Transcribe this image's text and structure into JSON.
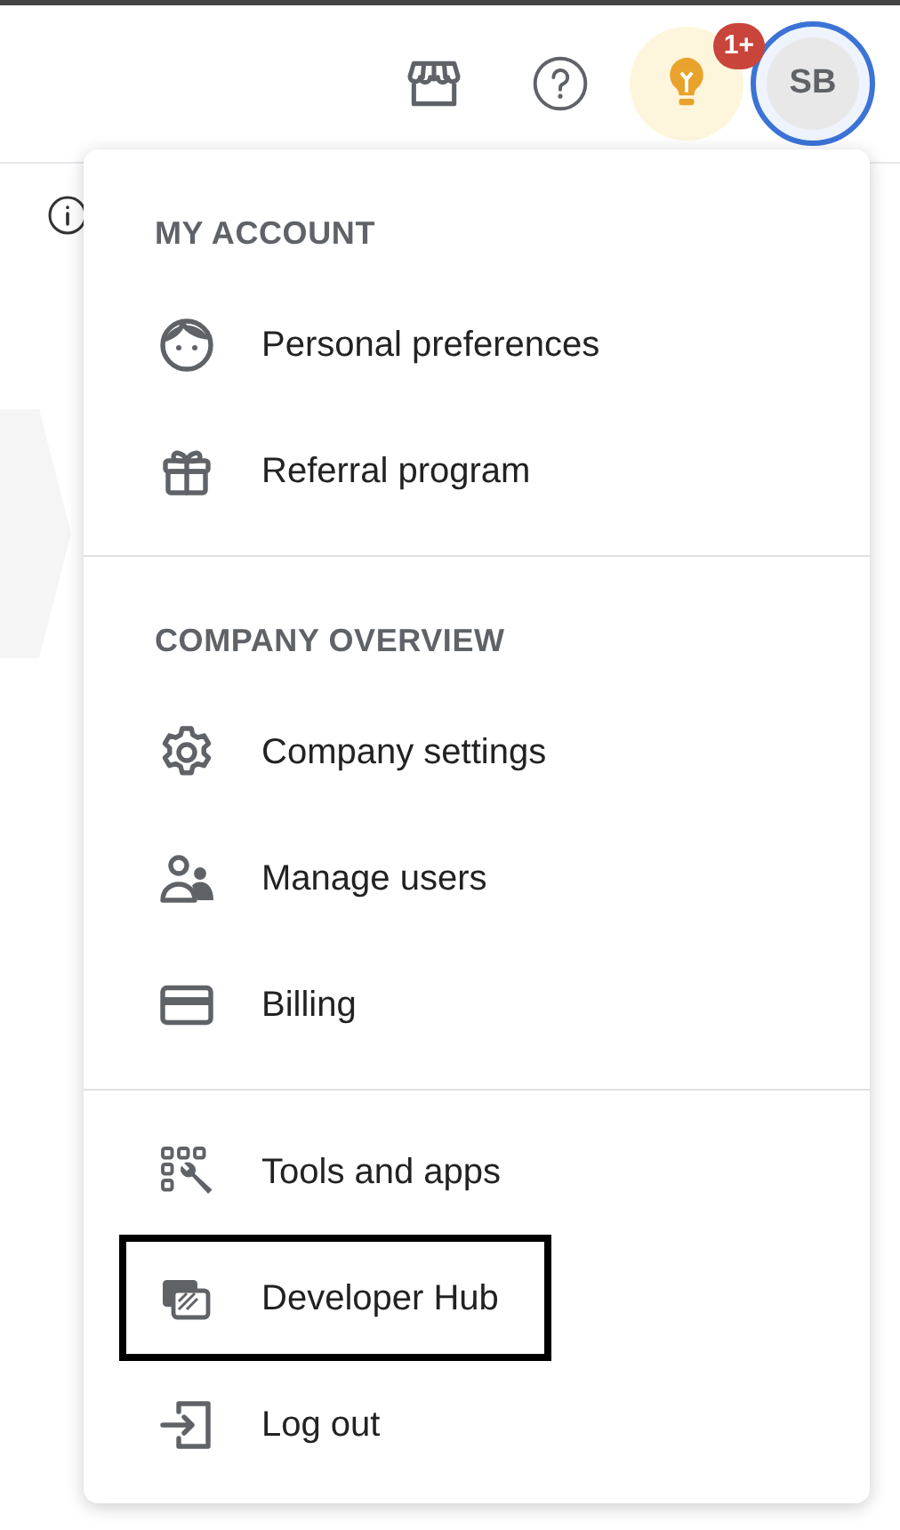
{
  "header": {
    "notification_badge": "1+",
    "avatar_initials": "SB",
    "avatar_focused": true
  },
  "menu": {
    "sections": [
      {
        "title": "MY ACCOUNT",
        "items": [
          {
            "kind": "face",
            "label": "Personal preferences",
            "highlighted": false
          },
          {
            "kind": "gift",
            "label": "Referral program",
            "highlighted": false
          }
        ]
      },
      {
        "title": "COMPANY OVERVIEW",
        "items": [
          {
            "kind": "gear",
            "label": "Company settings",
            "highlighted": false
          },
          {
            "kind": "users",
            "label": "Manage users",
            "highlighted": false
          },
          {
            "kind": "card",
            "label": "Billing",
            "highlighted": false
          }
        ]
      },
      {
        "items": [
          {
            "kind": "tools",
            "label": "Tools and apps",
            "highlighted": false
          },
          {
            "kind": "dev",
            "label": "Developer Hub",
            "highlighted": true
          },
          {
            "kind": "logout",
            "label": "Log out",
            "highlighted": false
          }
        ]
      }
    ]
  }
}
